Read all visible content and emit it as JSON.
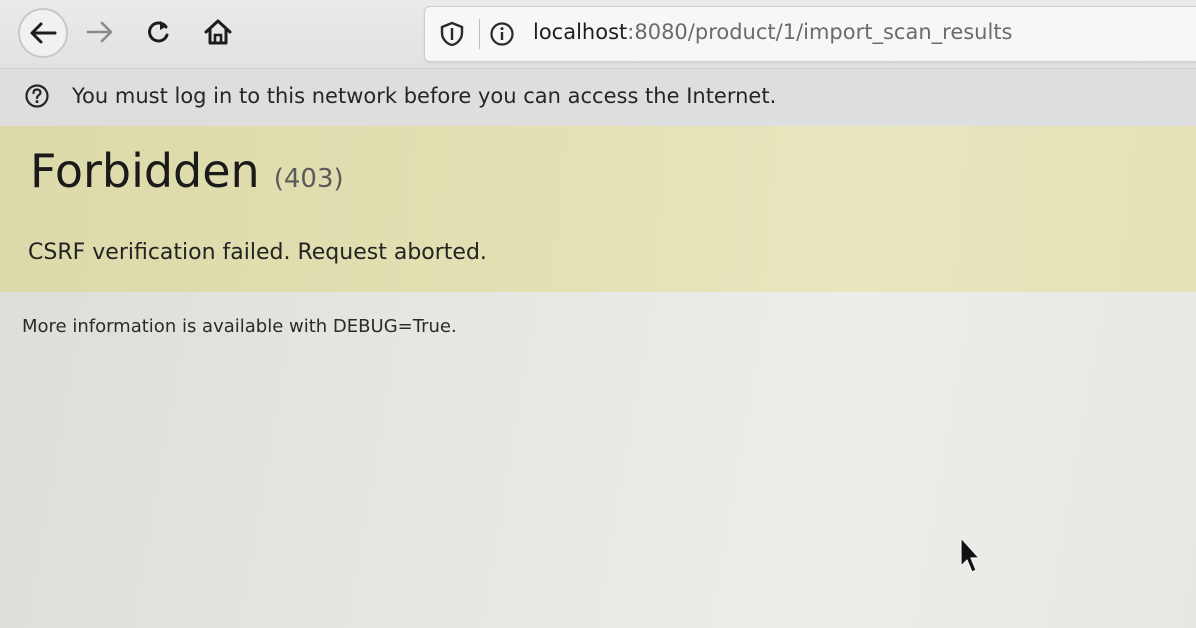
{
  "browser": {
    "nav": {
      "back_icon": "arrow-left-icon",
      "forward_icon": "arrow-right-icon",
      "reload_icon": "reload-icon",
      "home_icon": "home-icon"
    },
    "url": {
      "host": "localhost",
      "rest": ":8080/product/1/import_scan_results"
    }
  },
  "notice": {
    "icon": "help-circle-icon",
    "text": "You must log in to this network before you can access the Internet."
  },
  "error": {
    "title": "Forbidden",
    "code": "(403)",
    "message": "CSRF verification failed. Request aborted.",
    "background_color": "#e3e1b3"
  },
  "debug": {
    "text": "More information is available with DEBUG=True."
  }
}
